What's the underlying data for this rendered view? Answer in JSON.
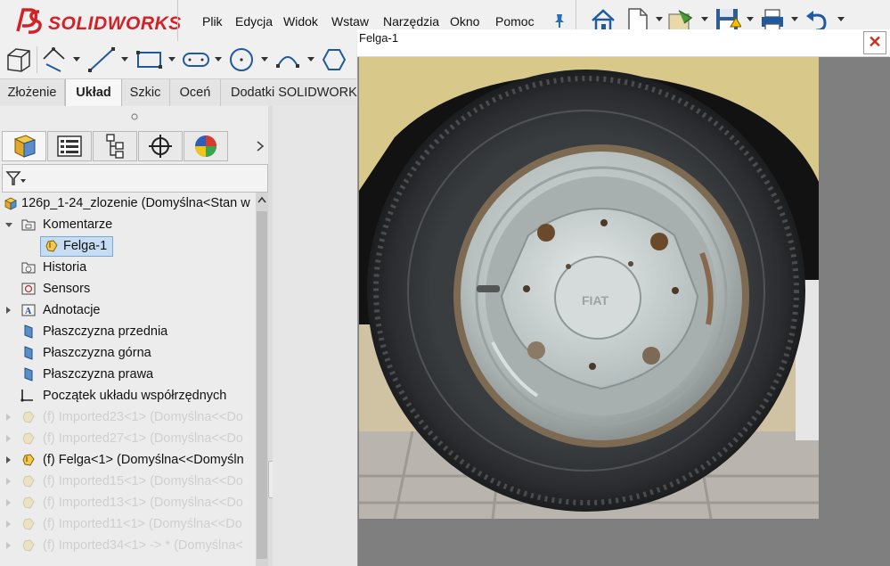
{
  "app": {
    "logo_ds": "3S",
    "logo_text": "SOLIDWORKS"
  },
  "menu": [
    "Plik",
    "Edycja",
    "Widok",
    "Wstaw",
    "Narzędzia",
    "Okno",
    "Pomoc"
  ],
  "command_tabs": [
    "Złożenie",
    "Układ",
    "Szkic",
    "Oceń",
    "Dodatki SOLIDWORKS"
  ],
  "active_tab": "Układ",
  "feature_tree": {
    "root": "126p_1-24_zlozenie  (Domyślna<Stan w",
    "items": [
      {
        "label": "Komentarze"
      },
      {
        "label": "Felga-1"
      },
      {
        "label": "Historia"
      },
      {
        "label": "Sensors"
      },
      {
        "label": "Adnotacje"
      },
      {
        "label": "Płaszczyzna przednia"
      },
      {
        "label": "Płaszczyzna górna"
      },
      {
        "label": "Płaszczyzna prawa"
      },
      {
        "label": "Początek układu współrzędnych"
      },
      {
        "label": "(f) Imported23<1> (Domyślna<<Do"
      },
      {
        "label": "(f) Imported27<1> (Domyślna<<Do"
      },
      {
        "label": "(f) Felga<1> (Domyślna<<Domyśln"
      },
      {
        "label": "(f) Imported15<1> (Domyślna<<Do"
      },
      {
        "label": "(f) Imported13<1> (Domyślna<<Do"
      },
      {
        "label": "(f) Imported11<1> (Domyślna<<Do"
      },
      {
        "label": "(f) Imported34<1> -> * (Domyślna<"
      }
    ]
  },
  "preview": {
    "title": "Felga-1",
    "close_glyph": "✕"
  },
  "colors": {
    "brand_red": "#d42027",
    "selection": "#c5dcf2",
    "preview_bg": "#7f7f7f"
  },
  "icons": [
    "home-icon",
    "new-document-icon",
    "rebuild-icon",
    "save-icon",
    "print-icon",
    "undo-icon",
    "pin-icon",
    "filter-icon",
    "assembly-icon",
    "part-icon",
    "plane-icon",
    "origin-icon",
    "annotation-icon",
    "sensor-icon",
    "history-icon",
    "folder-icon"
  ]
}
